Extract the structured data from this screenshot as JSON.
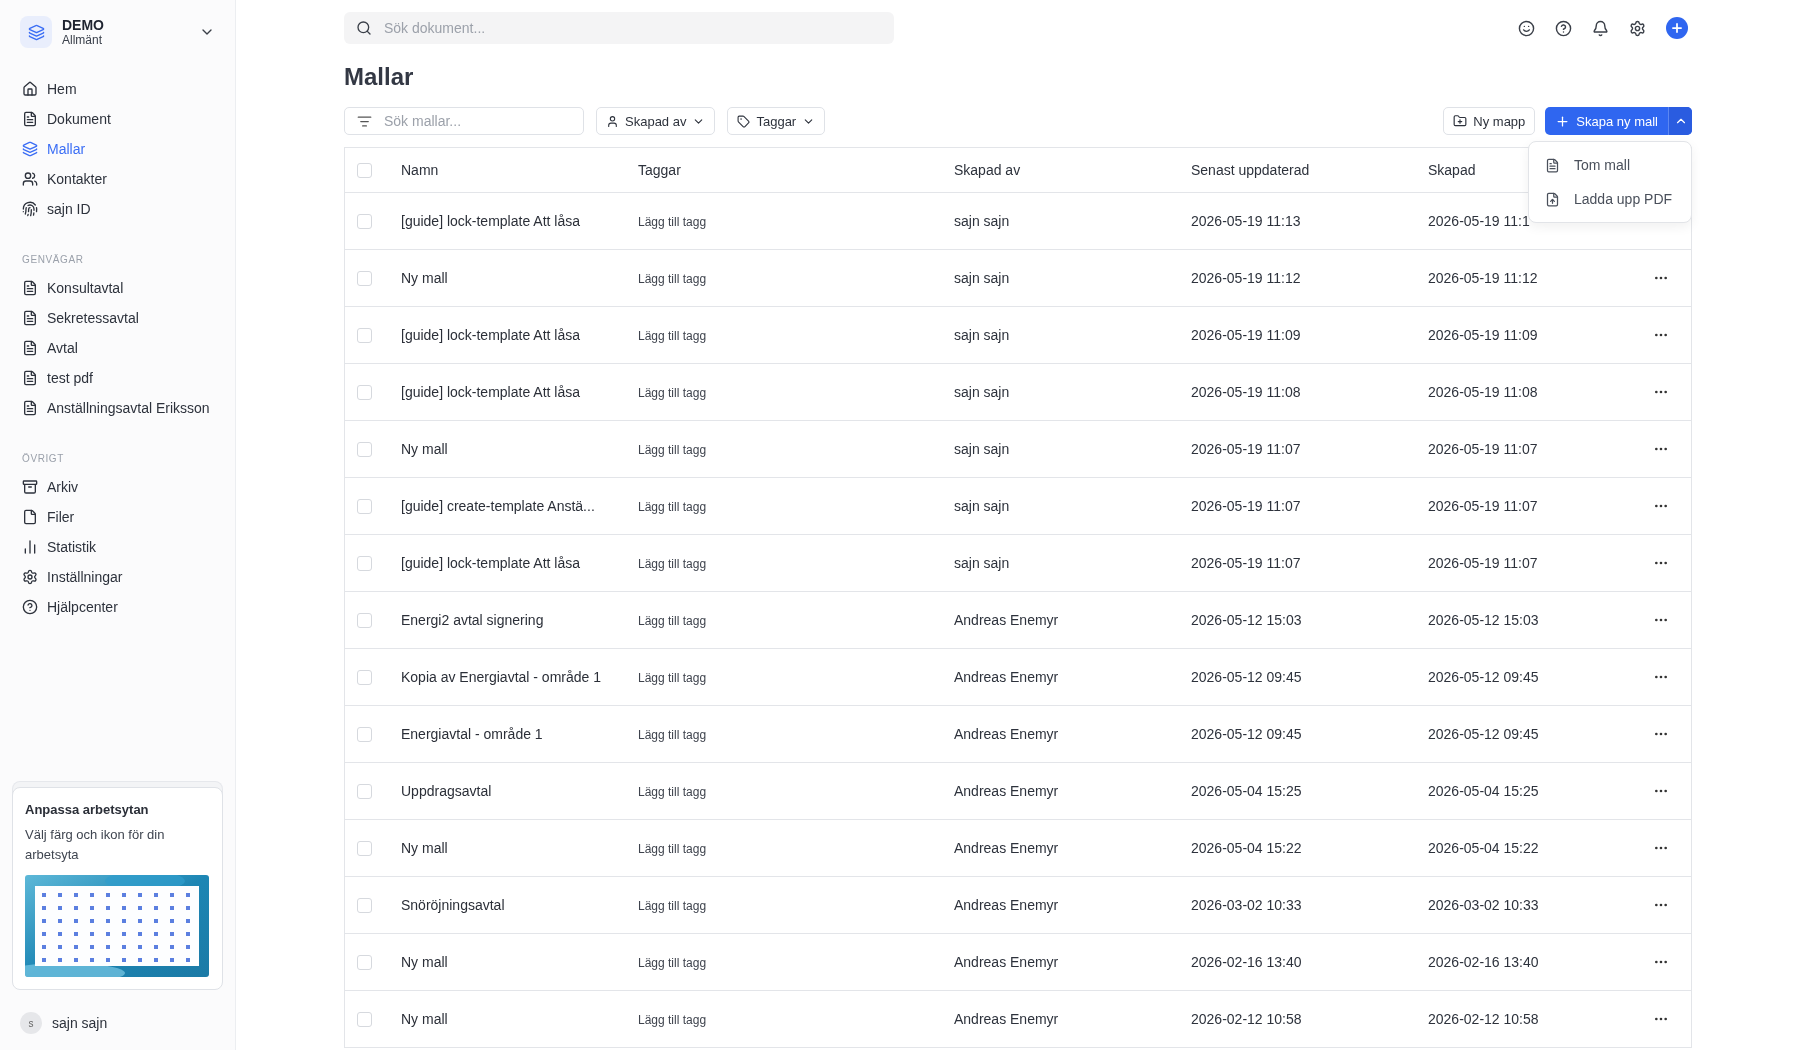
{
  "workspace": {
    "name": "DEMO",
    "subtitle": "Allmänt"
  },
  "nav": [
    {
      "label": "Hem",
      "selected": false
    },
    {
      "label": "Dokument",
      "selected": false
    },
    {
      "label": "Mallar",
      "selected": true
    },
    {
      "label": "Kontakter",
      "selected": false
    },
    {
      "label": "sajn ID",
      "selected": false
    }
  ],
  "shortcuts": {
    "heading": "GENVÄGAR",
    "items": [
      "Konsultavtal",
      "Sekretessavtal",
      "Avtal",
      "test pdf",
      "Anställningsavtal Eriksson"
    ]
  },
  "other": {
    "heading": "ÖVRIGT",
    "items": [
      "Arkiv",
      "Filer",
      "Statistik",
      "Inställningar",
      "Hjälpcenter"
    ]
  },
  "promo": {
    "title": "Anpassa arbetsytan",
    "text": "Välj färg och ikon för din arbetsyta"
  },
  "user": {
    "initial": "s",
    "name": "sajn sajn"
  },
  "search": {
    "placeholder": "Sök dokument..."
  },
  "page_title": "Mallar",
  "toolbar": {
    "search_placeholder": "Sök mallar...",
    "filters": [
      "Skapad av",
      "Taggar"
    ],
    "new_folder": "Ny mapp",
    "create": "Skapa ny mall"
  },
  "create_menu": {
    "open": true,
    "items": [
      "Tom mall",
      "Ladda upp PDF"
    ]
  },
  "table": {
    "columns": [
      "Namn",
      "Taggar",
      "Skapad av",
      "Senast uppdaterad",
      "Skapad"
    ],
    "select_all_checked": false,
    "rows": [
      {
        "checked": false,
        "name": "[guide] lock-template Att låsa",
        "tag": "Lägg till tagg",
        "author": "sajn sajn",
        "updated": "2026-05-19 11:13",
        "created": "2026-05-19 11:1"
      },
      {
        "checked": false,
        "name": "Ny mall",
        "tag": "Lägg till tagg",
        "author": "sajn sajn",
        "updated": "2026-05-19 11:12",
        "created": "2026-05-19 11:12"
      },
      {
        "checked": false,
        "name": "[guide] lock-template Att låsa",
        "tag": "Lägg till tagg",
        "author": "sajn sajn",
        "updated": "2026-05-19 11:09",
        "created": "2026-05-19 11:09"
      },
      {
        "checked": false,
        "name": "[guide] lock-template Att låsa",
        "tag": "Lägg till tagg",
        "author": "sajn sajn",
        "updated": "2026-05-19 11:08",
        "created": "2026-05-19 11:08"
      },
      {
        "checked": false,
        "name": "Ny mall",
        "tag": "Lägg till tagg",
        "author": "sajn sajn",
        "updated": "2026-05-19 11:07",
        "created": "2026-05-19 11:07"
      },
      {
        "checked": false,
        "name": "[guide] create-template Anstä...",
        "tag": "Lägg till tagg",
        "author": "sajn sajn",
        "updated": "2026-05-19 11:07",
        "created": "2026-05-19 11:07"
      },
      {
        "checked": false,
        "name": "[guide] lock-template Att låsa",
        "tag": "Lägg till tagg",
        "author": "sajn sajn",
        "updated": "2026-05-19 11:07",
        "created": "2026-05-19 11:07"
      },
      {
        "checked": false,
        "name": "Energi2 avtal signering",
        "tag": "Lägg till tagg",
        "author": "Andreas Enemyr",
        "updated": "2026-05-12 15:03",
        "created": "2026-05-12 15:03"
      },
      {
        "checked": false,
        "name": "Kopia av Energiavtal - område 1",
        "tag": "Lägg till tagg",
        "author": "Andreas Enemyr",
        "updated": "2026-05-12 09:45",
        "created": "2026-05-12 09:45"
      },
      {
        "checked": false,
        "name": "Energiavtal - område 1",
        "tag": "Lägg till tagg",
        "author": "Andreas Enemyr",
        "updated": "2026-05-12 09:45",
        "created": "2026-05-12 09:45"
      },
      {
        "checked": false,
        "name": "Uppdragsavtal",
        "tag": "Lägg till tagg",
        "author": "Andreas Enemyr",
        "updated": "2026-05-04 15:25",
        "created": "2026-05-04 15:25"
      },
      {
        "checked": false,
        "name": "Ny mall",
        "tag": "Lägg till tagg",
        "author": "Andreas Enemyr",
        "updated": "2026-05-04 15:22",
        "created": "2026-05-04 15:22"
      },
      {
        "checked": false,
        "name": "Snöröjningsavtal",
        "tag": "Lägg till tagg",
        "author": "Andreas Enemyr",
        "updated": "2026-03-02 10:33",
        "created": "2026-03-02 10:33"
      },
      {
        "checked": false,
        "name": "Ny mall",
        "tag": "Lägg till tagg",
        "author": "Andreas Enemyr",
        "updated": "2026-02-16 13:40",
        "created": "2026-02-16 13:40"
      },
      {
        "checked": false,
        "name": "Ny mall",
        "tag": "Lägg till tagg",
        "author": "Andreas Enemyr",
        "updated": "2026-02-12 10:58",
        "created": "2026-02-12 10:58"
      }
    ]
  }
}
